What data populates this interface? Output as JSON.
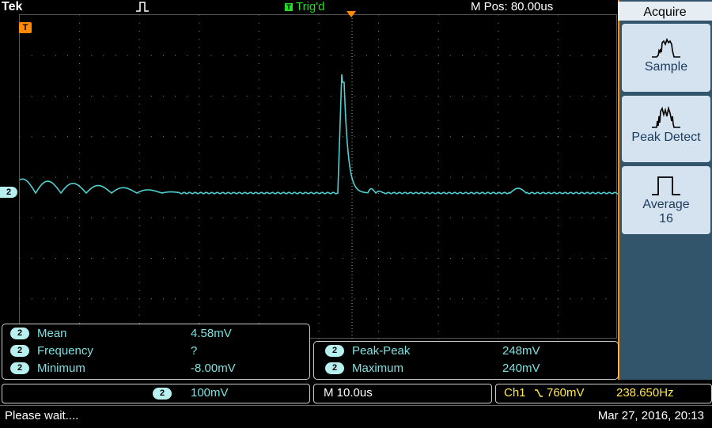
{
  "header": {
    "brand": "Tek",
    "trigger_status": "Trig'd",
    "trigger_badge": "T",
    "m_pos": "M Pos: 80.00us"
  },
  "markers": {
    "trigger_marker": "T",
    "channel_marker": "2"
  },
  "menu": {
    "title": "Acquire",
    "buttons": [
      {
        "label": "Sample",
        "sub": "",
        "icon": "sample-waveform-icon"
      },
      {
        "label": "Peak Detect",
        "sub": "",
        "icon": "peak-detect-waveform-icon"
      },
      {
        "label": "Average",
        "sub": "16",
        "icon": "average-waveform-icon"
      }
    ]
  },
  "measurements_left": [
    {
      "ch": "2",
      "label": "Mean",
      "value": "4.58mV"
    },
    {
      "ch": "2",
      "label": "Frequency",
      "value": "?"
    },
    {
      "ch": "2",
      "label": "Minimum",
      "value": "-8.00mV"
    }
  ],
  "measurements_right": [
    {
      "ch": "2",
      "label": "Peak-Peak",
      "value": "248mV"
    },
    {
      "ch": "2",
      "label": "Maximum",
      "value": "240mV"
    }
  ],
  "bottom": {
    "ch_badge": "2",
    "ch_scale": "100mV",
    "timebase": "M 10.0us",
    "trigger_source": "Ch1",
    "trigger_slope_icon": "falling-edge-icon",
    "trigger_level": "760mV",
    "frequency": "238.650Hz"
  },
  "status": {
    "message": "Please wait....",
    "datetime": "Mar 27, 2016, 20:13"
  },
  "colors": {
    "trace": "#4fd0d0",
    "accent": "#ff8a00",
    "trigger_text": "#ffe94d"
  }
}
